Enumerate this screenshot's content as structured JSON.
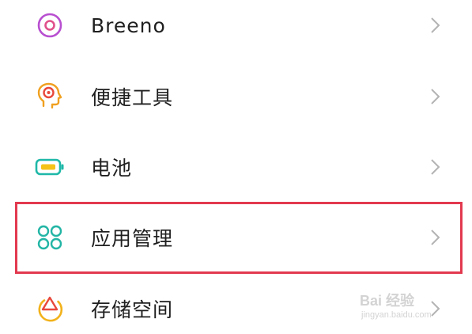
{
  "settings": {
    "items": [
      {
        "label": "Breeno",
        "icon": "breeno-icon",
        "color": "#b84fd0"
      },
      {
        "label": "便捷工具",
        "icon": "convenience-tools-icon",
        "color": "#f0a020"
      },
      {
        "label": "电池",
        "icon": "battery-icon",
        "color": "#1fb8a8"
      },
      {
        "label": "应用管理",
        "icon": "app-management-icon",
        "color": "#22b5a5"
      },
      {
        "label": "存储空间",
        "icon": "storage-icon",
        "color": "#f2b21b",
        "accent": "#e8483c"
      }
    ],
    "chevron_icon": "chevron-right-icon",
    "highlight_color": "#e2394f"
  },
  "watermark": {
    "line1": "Bai 经验",
    "line2": "jingyan.baidu.com"
  }
}
